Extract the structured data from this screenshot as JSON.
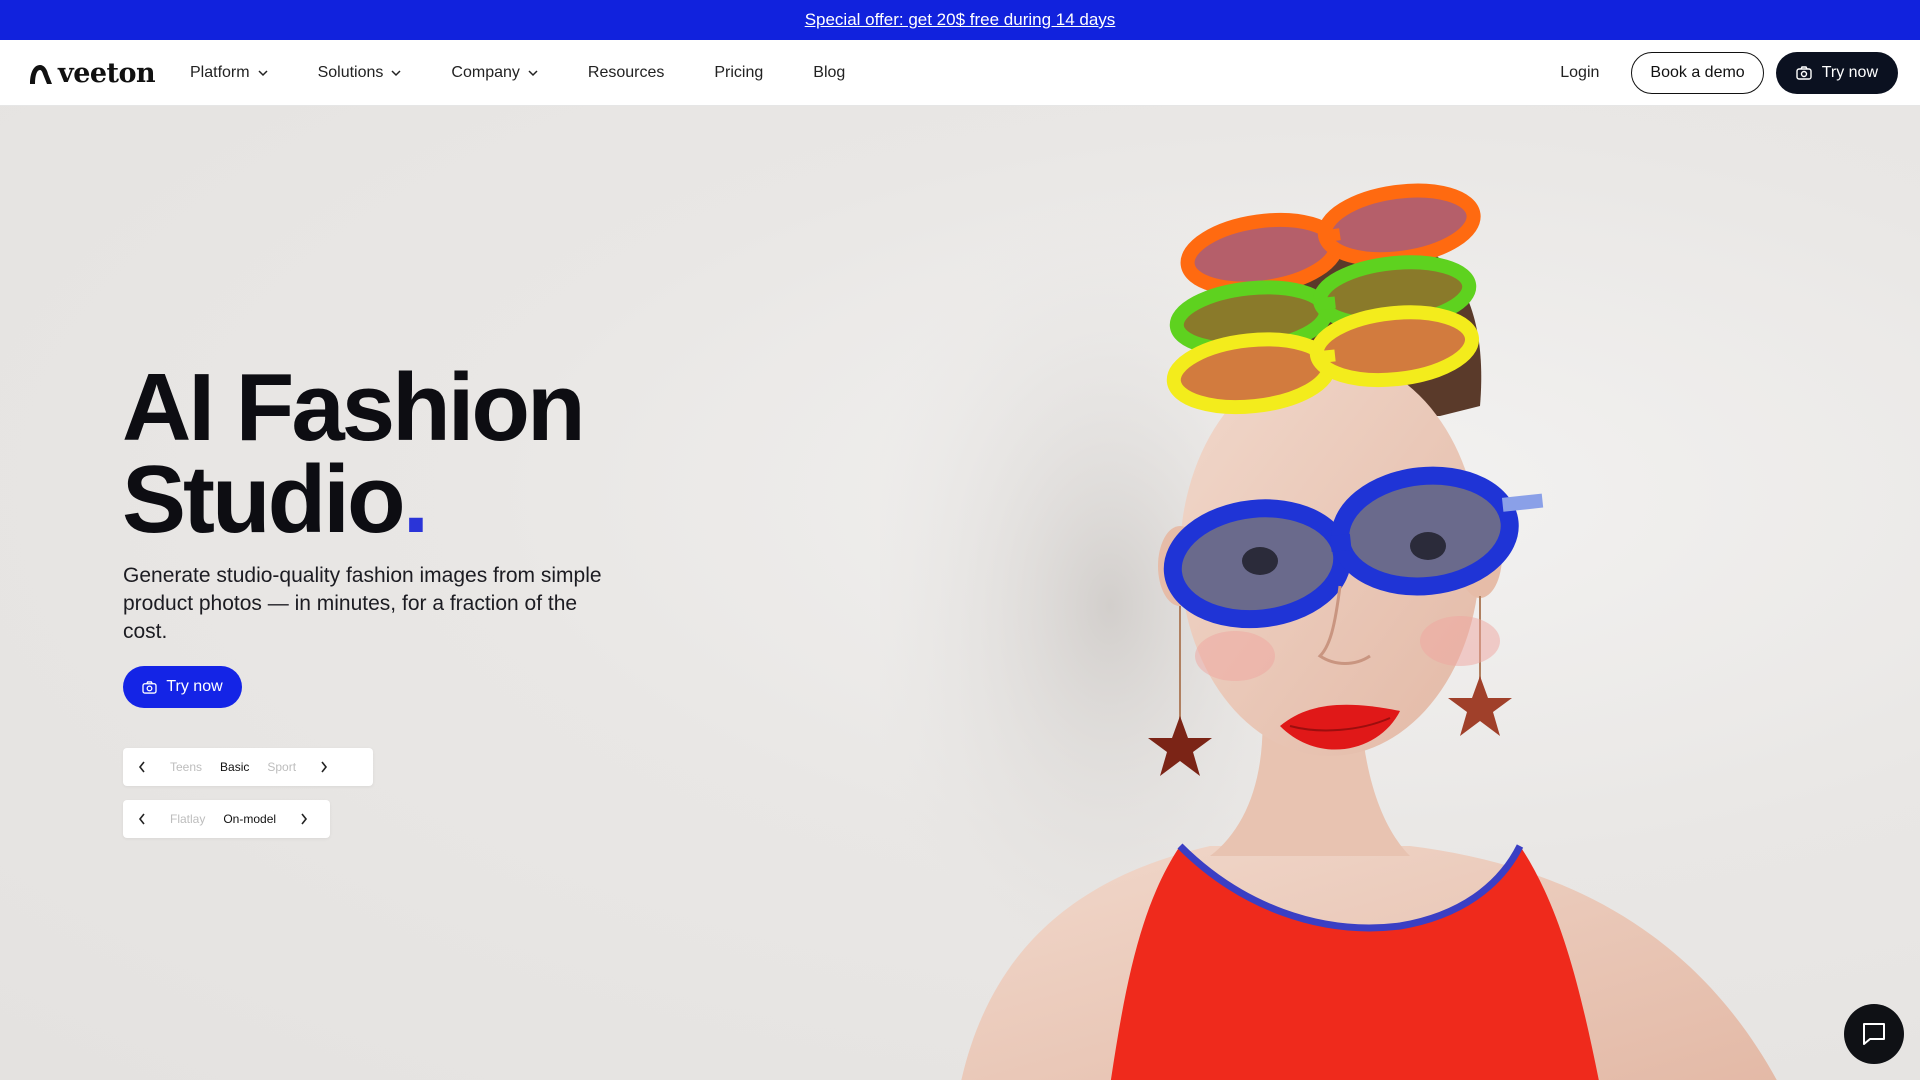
{
  "promo": {
    "text": "Special offer: get 20$ free during 14 days"
  },
  "nav": {
    "logo": "veeton",
    "menu": [
      {
        "label": "Platform",
        "dropdown": true
      },
      {
        "label": "Solutions",
        "dropdown": true
      },
      {
        "label": "Company",
        "dropdown": true
      },
      {
        "label": "Resources",
        "dropdown": false
      },
      {
        "label": "Pricing",
        "dropdown": false
      },
      {
        "label": "Blog",
        "dropdown": false
      }
    ],
    "login": "Login",
    "demo": "Book a demo",
    "try": "Try now"
  },
  "hero": {
    "title_line1": "AI Fashion",
    "title_line2": "Studio",
    "title_dot": ".",
    "subtitle": "Generate studio-quality fashion images from simple product photos — in minutes, for a fraction of the cost.",
    "cta": "Try now",
    "selector1": {
      "prev": "Teens",
      "current": "Basic",
      "next": "Sport"
    },
    "selector2": {
      "prev": "Flatlay",
      "current": "On-model"
    }
  },
  "colors": {
    "accent": "#1424e6",
    "promo": "#1122dd",
    "dark": "#0b1120"
  }
}
